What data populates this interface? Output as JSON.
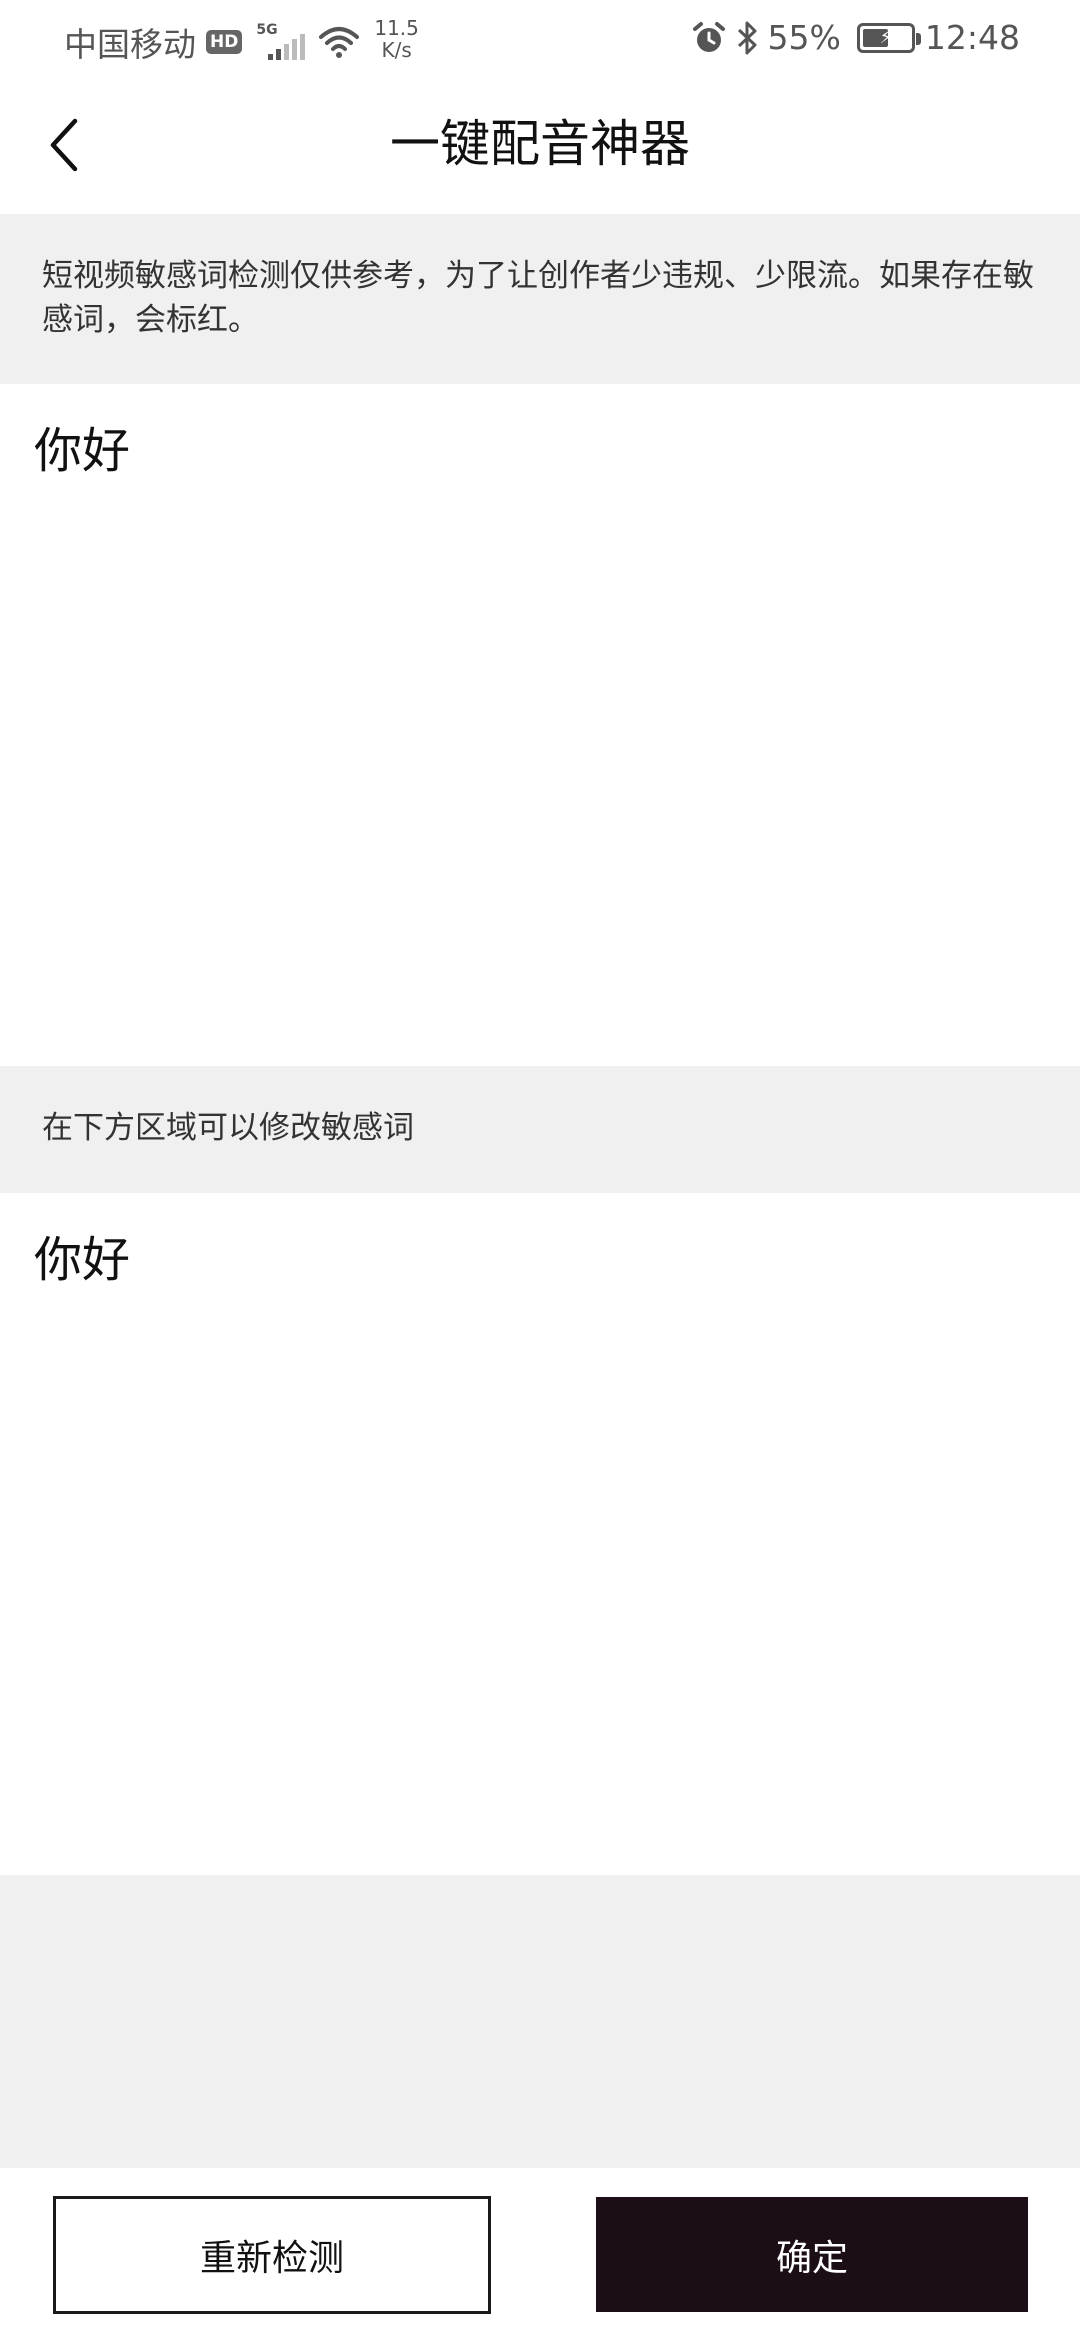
{
  "status_bar": {
    "carrier": "中国移动",
    "hd_badge": "HD",
    "network_type": "5G",
    "net_speed_value": "11.5",
    "net_speed_unit": "K/s",
    "battery_percent": "55%",
    "battery_level": 0.55,
    "time": "12:48",
    "icons": [
      "signal-icon",
      "wifi-icon",
      "alarm-icon",
      "bluetooth-icon",
      "battery-icon"
    ]
  },
  "header": {
    "title": "一键配音神器",
    "back_icon": "chevron-left-icon"
  },
  "notice": {
    "text": "短视频敏感词检测仅供参考，为了让创作者少违规、少限流。如果存在敏感词，会标红。"
  },
  "result": {
    "text": "你好"
  },
  "hint": {
    "text": "在下方区域可以修改敏感词"
  },
  "editor": {
    "value": "你好"
  },
  "buttons": {
    "recheck_label": "重新检测",
    "confirm_label": "确定"
  },
  "colors": {
    "accent": "#1c0e17",
    "panel_background": "#f0f0f0",
    "sensitive_highlight": "#e02020"
  }
}
